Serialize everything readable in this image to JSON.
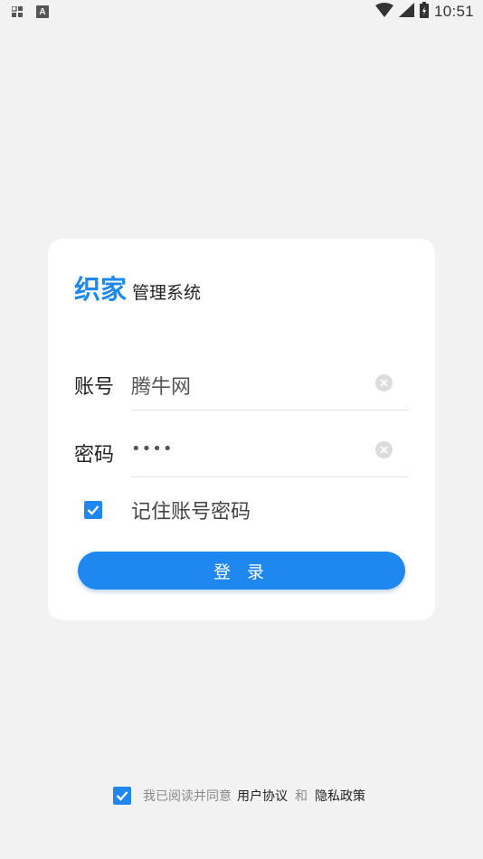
{
  "status_bar": {
    "left_icons": [
      "apps-icon",
      "keyboard-a-icon"
    ],
    "a_glyph": "A",
    "time": "10:51",
    "right_icons": [
      "wifi-icon",
      "cell-signal-icon",
      "battery-charging-icon"
    ]
  },
  "brand": {
    "main": "织家",
    "sub": "管理系统",
    "color": "#1e88f0"
  },
  "form": {
    "account_label": "账号",
    "account_value": "腾牛网",
    "password_label": "密码",
    "password_value": "••••",
    "remember_label": "记住账号密码",
    "remember_checked": true,
    "login_button": "登 录"
  },
  "agreement": {
    "checked": true,
    "prefix": "我已阅读并同意",
    "user_agreement": "用户协议",
    "and": "和",
    "privacy_policy": "隐私政策"
  },
  "colors": {
    "accent": "#1e88f0",
    "background": "#f2f2f2",
    "card": "#ffffff"
  }
}
